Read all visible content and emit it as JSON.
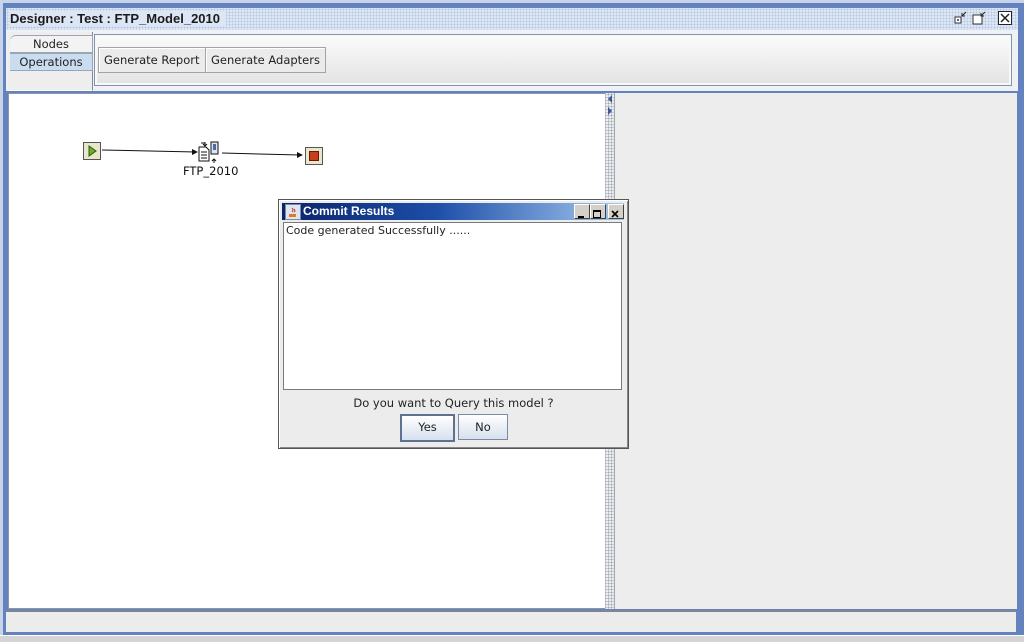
{
  "window": {
    "title": "Designer : Test : FTP_Model_2010",
    "controls": [
      "minimize-icon",
      "restore-icon",
      "close-icon"
    ]
  },
  "side_tabs": [
    {
      "label": "Nodes",
      "selected": false
    },
    {
      "label": "Operations",
      "selected": true
    }
  ],
  "operations": {
    "generate_report": "Generate Report",
    "generate_adapters": "Generate Adapters"
  },
  "canvas": {
    "nodes": [
      {
        "type": "start",
        "icon": "play-icon"
      },
      {
        "type": "ftp",
        "label": "FTP_2010",
        "icon": "ftp-document-icon"
      },
      {
        "type": "stop",
        "icon": "stop-icon"
      }
    ]
  },
  "splitter": {
    "collapse_left": "arrow-left-icon",
    "collapse_right": "arrow-right-icon"
  },
  "dialog": {
    "title": "Commit Results",
    "message": "Code generated Successfully ......",
    "question": "Do you want to Query this model ?",
    "yes_label": "Yes",
    "no_label": "No",
    "colors": {
      "title_start": "#0a246a",
      "title_end": "#a6caf0"
    }
  },
  "colors": {
    "frame": "#6382be",
    "canvas": "#ffffff",
    "panel": "#ededed"
  }
}
